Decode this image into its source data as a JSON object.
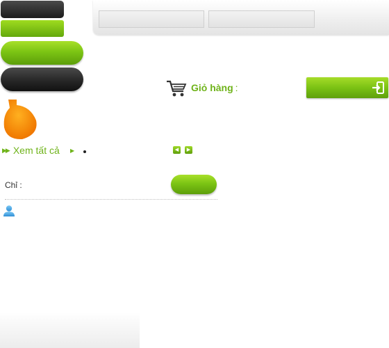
{
  "cart": {
    "label": "Giỏ hàng",
    "colon": ":"
  },
  "see_all": {
    "label": "Xem tất cả"
  },
  "filter": {
    "label": "Chỉ :"
  },
  "search": {
    "field1_value": "",
    "field2_value": ""
  },
  "icons": {
    "cart": "shopping-cart-icon",
    "login": "login-icon",
    "user": "user-icon",
    "prev": "arrow-left-icon",
    "next": "arrow-right-icon",
    "see_all": "double-chevron-right-icon"
  },
  "colors": {
    "accent": "#6fb31a",
    "orange": "#ff9900",
    "dark": "#222222"
  }
}
